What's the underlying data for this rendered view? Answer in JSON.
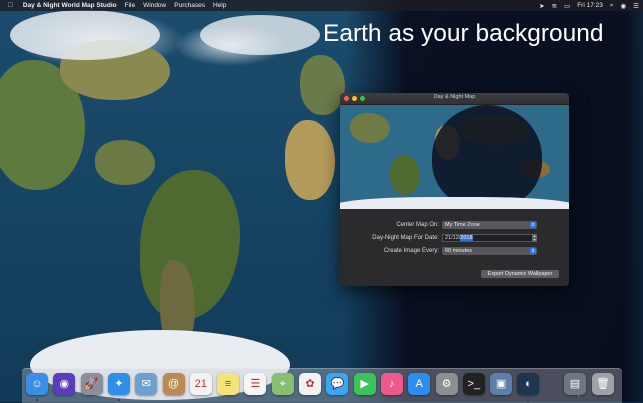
{
  "menubar": {
    "apple_icon": "apple-logo",
    "app_name": "Day & Night World Map Studio",
    "menus": [
      "File",
      "Window",
      "Purchases",
      "Help"
    ],
    "clock": "Fri 17:23",
    "status_icons": [
      "location-arrow-icon",
      "wifi-icon",
      "battery-icon",
      "search-icon",
      "siri-icon",
      "notification-list-icon"
    ]
  },
  "headline": "Earth as your background",
  "window": {
    "title": "Day & Night Map",
    "traffic_light_colors": [
      "#fc5f57",
      "#fdbc2e",
      "#33c748"
    ],
    "fields": {
      "center_label": "Center Map On:",
      "center_value": "My Time Zone",
      "date_label": "Day-Night Map For Date:",
      "date_day": "21/12/",
      "date_year": "2018",
      "interval_label": "Create Image Every:",
      "interval_value": "60 minutes"
    },
    "export_button": "Export Dynamic Wallpaper"
  },
  "dock": {
    "apps": [
      {
        "name": "finder-icon",
        "glyph": "☺",
        "color": "#3a8ee6",
        "running": true
      },
      {
        "name": "siri-icon",
        "glyph": "◉",
        "color": "#5a3dbb",
        "running": false
      },
      {
        "name": "launchpad-icon",
        "glyph": "🚀",
        "color": "#8a8f99",
        "running": false
      },
      {
        "name": "safari-icon",
        "glyph": "✦",
        "color": "#2d8fe8",
        "running": true
      },
      {
        "name": "mail-icon",
        "glyph": "✉",
        "color": "#6f9fce",
        "running": false
      },
      {
        "name": "contacts-icon",
        "glyph": "@",
        "color": "#b88b55",
        "running": false
      },
      {
        "name": "calendar-icon",
        "glyph": "21",
        "color": "#f3f3f3",
        "running": false
      },
      {
        "name": "notes-icon",
        "glyph": "≡",
        "color": "#f4e27a",
        "running": false
      },
      {
        "name": "reminders-icon",
        "glyph": "☰",
        "color": "#f5f5f5",
        "running": false
      },
      {
        "name": "maps-icon",
        "glyph": "⌖",
        "color": "#88c070",
        "running": false
      },
      {
        "name": "photos-icon",
        "glyph": "✿",
        "color": "#f2f2f2",
        "running": false
      },
      {
        "name": "messages-icon",
        "glyph": "💬",
        "color": "#3aa7f0",
        "running": false
      },
      {
        "name": "facetime-icon",
        "glyph": "▶",
        "color": "#3cc35a",
        "running": false
      },
      {
        "name": "itunes-icon",
        "glyph": "♪",
        "color": "#f05a8a",
        "running": false
      },
      {
        "name": "app-store-icon",
        "glyph": "A",
        "color": "#2c8cf2",
        "running": false
      },
      {
        "name": "system-preferences-icon",
        "glyph": "⚙",
        "color": "#8d8f94",
        "running": false
      },
      {
        "name": "terminal-icon",
        "glyph": ">_",
        "color": "#222222",
        "running": false
      },
      {
        "name": "preview-icon",
        "glyph": "▣",
        "color": "#5b7fa8",
        "running": false
      },
      {
        "name": "day-night-map-icon",
        "glyph": "◐",
        "color": "#1d3550",
        "running": true
      }
    ],
    "extras": [
      {
        "name": "downloads-stack-icon",
        "glyph": "▤",
        "color": "#6f7782"
      },
      {
        "name": "trash-icon",
        "glyph": "🗑",
        "color": "#9ea3a8"
      }
    ]
  }
}
